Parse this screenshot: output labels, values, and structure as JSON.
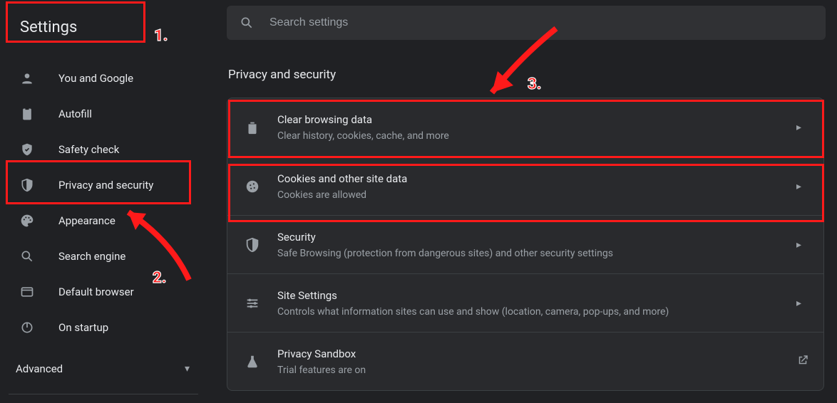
{
  "sidebar": {
    "title": "Settings",
    "items": [
      {
        "label": "You and Google"
      },
      {
        "label": "Autofill"
      },
      {
        "label": "Safety check"
      },
      {
        "label": "Privacy and security"
      },
      {
        "label": "Appearance"
      },
      {
        "label": "Search engine"
      },
      {
        "label": "Default browser"
      },
      {
        "label": "On startup"
      }
    ],
    "advanced_label": "Advanced"
  },
  "search": {
    "placeholder": "Search settings"
  },
  "main": {
    "section_title": "Privacy and security",
    "rows": [
      {
        "title": "Clear browsing data",
        "sub": "Clear history, cookies, cache, and more"
      },
      {
        "title": "Cookies and other site data",
        "sub": "Cookies are allowed"
      },
      {
        "title": "Security",
        "sub": "Safe Browsing (protection from dangerous sites) and other security settings"
      },
      {
        "title": "Site Settings",
        "sub": "Controls what information sites can use and show (location, camera, pop-ups, and more)"
      },
      {
        "title": "Privacy Sandbox",
        "sub": "Trial features are on"
      }
    ]
  },
  "annotations": {
    "step1": "1.",
    "step2": "2.",
    "step3": "3."
  }
}
